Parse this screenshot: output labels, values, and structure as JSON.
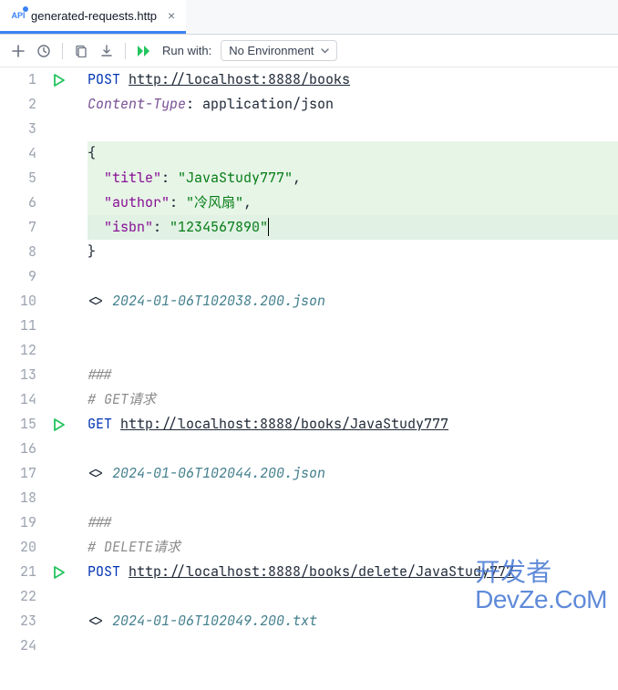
{
  "tab": {
    "filename": "generated-requests.http"
  },
  "toolbar": {
    "run_with_label": "Run with:",
    "environment": "No Environment"
  },
  "code": {
    "lines": [
      {
        "n": "1",
        "run": true
      },
      {
        "n": "2"
      },
      {
        "n": "3"
      },
      {
        "n": "4",
        "hl": "green"
      },
      {
        "n": "5",
        "hl": "green"
      },
      {
        "n": "6",
        "hl": "green"
      },
      {
        "n": "7",
        "hl": "green cursor"
      },
      {
        "n": "8"
      },
      {
        "n": "9"
      },
      {
        "n": "10"
      },
      {
        "n": "11"
      },
      {
        "n": "12"
      },
      {
        "n": "13"
      },
      {
        "n": "14"
      },
      {
        "n": "15",
        "run": true
      },
      {
        "n": "16"
      },
      {
        "n": "17"
      },
      {
        "n": "18"
      },
      {
        "n": "19"
      },
      {
        "n": "20"
      },
      {
        "n": "21",
        "run": true
      },
      {
        "n": "22"
      },
      {
        "n": "23"
      },
      {
        "n": "24"
      }
    ],
    "tokens": {
      "post": "POST",
      "get": "GET",
      "url_books": "http://localhost:8888/books",
      "header_ct": "Content-Type",
      "header_sep": ": ",
      "header_val": "application/json",
      "brace_open": "{",
      "brace_close": "}",
      "key_title": "\"title\"",
      "val_title": "\"JavaStudy777\"",
      "key_author": "\"author\"",
      "val_author": "\"冷风扇\"",
      "key_isbn": "\"isbn\"",
      "val_isbn": "\"1234567890\"",
      "comma": ",",
      "colon_sp": ": ",
      "resp_prefix": "<> ",
      "resp1": "2024-01-06T102038.200.json",
      "sep": "###",
      "c_get": "# GET请求",
      "url_get": "http://localhost:8888/books/JavaStudy777",
      "resp2": "2024-01-06T102044.200.json",
      "c_del": "# DELETE请求",
      "url_del": "http://localhost:8888/books/delete/JavaStudy777",
      "resp3": "2024-01-06T102049.200.txt"
    }
  },
  "watermark": {
    "line1": "开发者",
    "line2": "DevZe.CoM"
  }
}
